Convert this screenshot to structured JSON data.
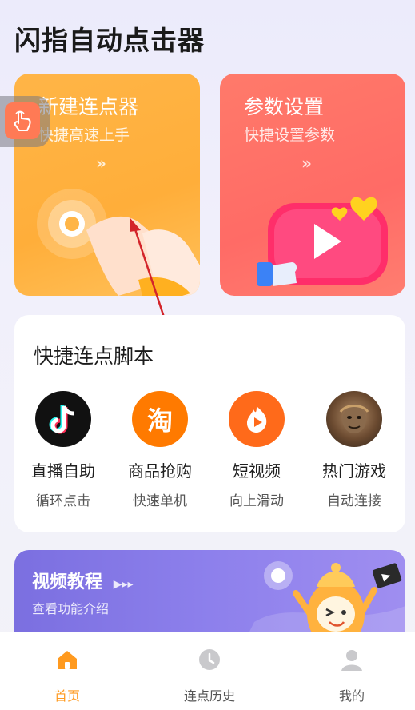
{
  "app": {
    "title": "闪指自动点击器"
  },
  "cards": {
    "new_clicker": {
      "title": "新建连点器",
      "subtitle": "快捷高速上手",
      "chevron": "»"
    },
    "params": {
      "title": "参数设置",
      "subtitle": "快捷设置参数",
      "chevron": "»"
    }
  },
  "quick_scripts": {
    "title": "快捷连点脚本",
    "items": [
      {
        "name": "直播自助",
        "desc": "循环点击",
        "icon": "tiktok-icon"
      },
      {
        "name": "商品抢购",
        "desc": "快速单机",
        "icon": "taobao-icon",
        "icon_glyph": "淘"
      },
      {
        "name": "短视频",
        "desc": "向上滑动",
        "icon": "short-video-icon"
      },
      {
        "name": "热门游戏",
        "desc": "自动连接",
        "icon": "game-avatar-icon"
      }
    ]
  },
  "video_banner": {
    "title": "视频教程",
    "subtitle": "查看功能介绍",
    "arrows": "▶▸▸"
  },
  "tabs": [
    {
      "label": "首页",
      "icon": "home-icon",
      "active": true
    },
    {
      "label": "连点历史",
      "icon": "clock-icon",
      "active": false
    },
    {
      "label": "我的",
      "icon": "user-icon",
      "active": false
    }
  ],
  "colors": {
    "accent": "#ff9a1f",
    "card_new": "#ffb547",
    "card_params": "#ff6b66",
    "banner": "#8d80ec"
  }
}
